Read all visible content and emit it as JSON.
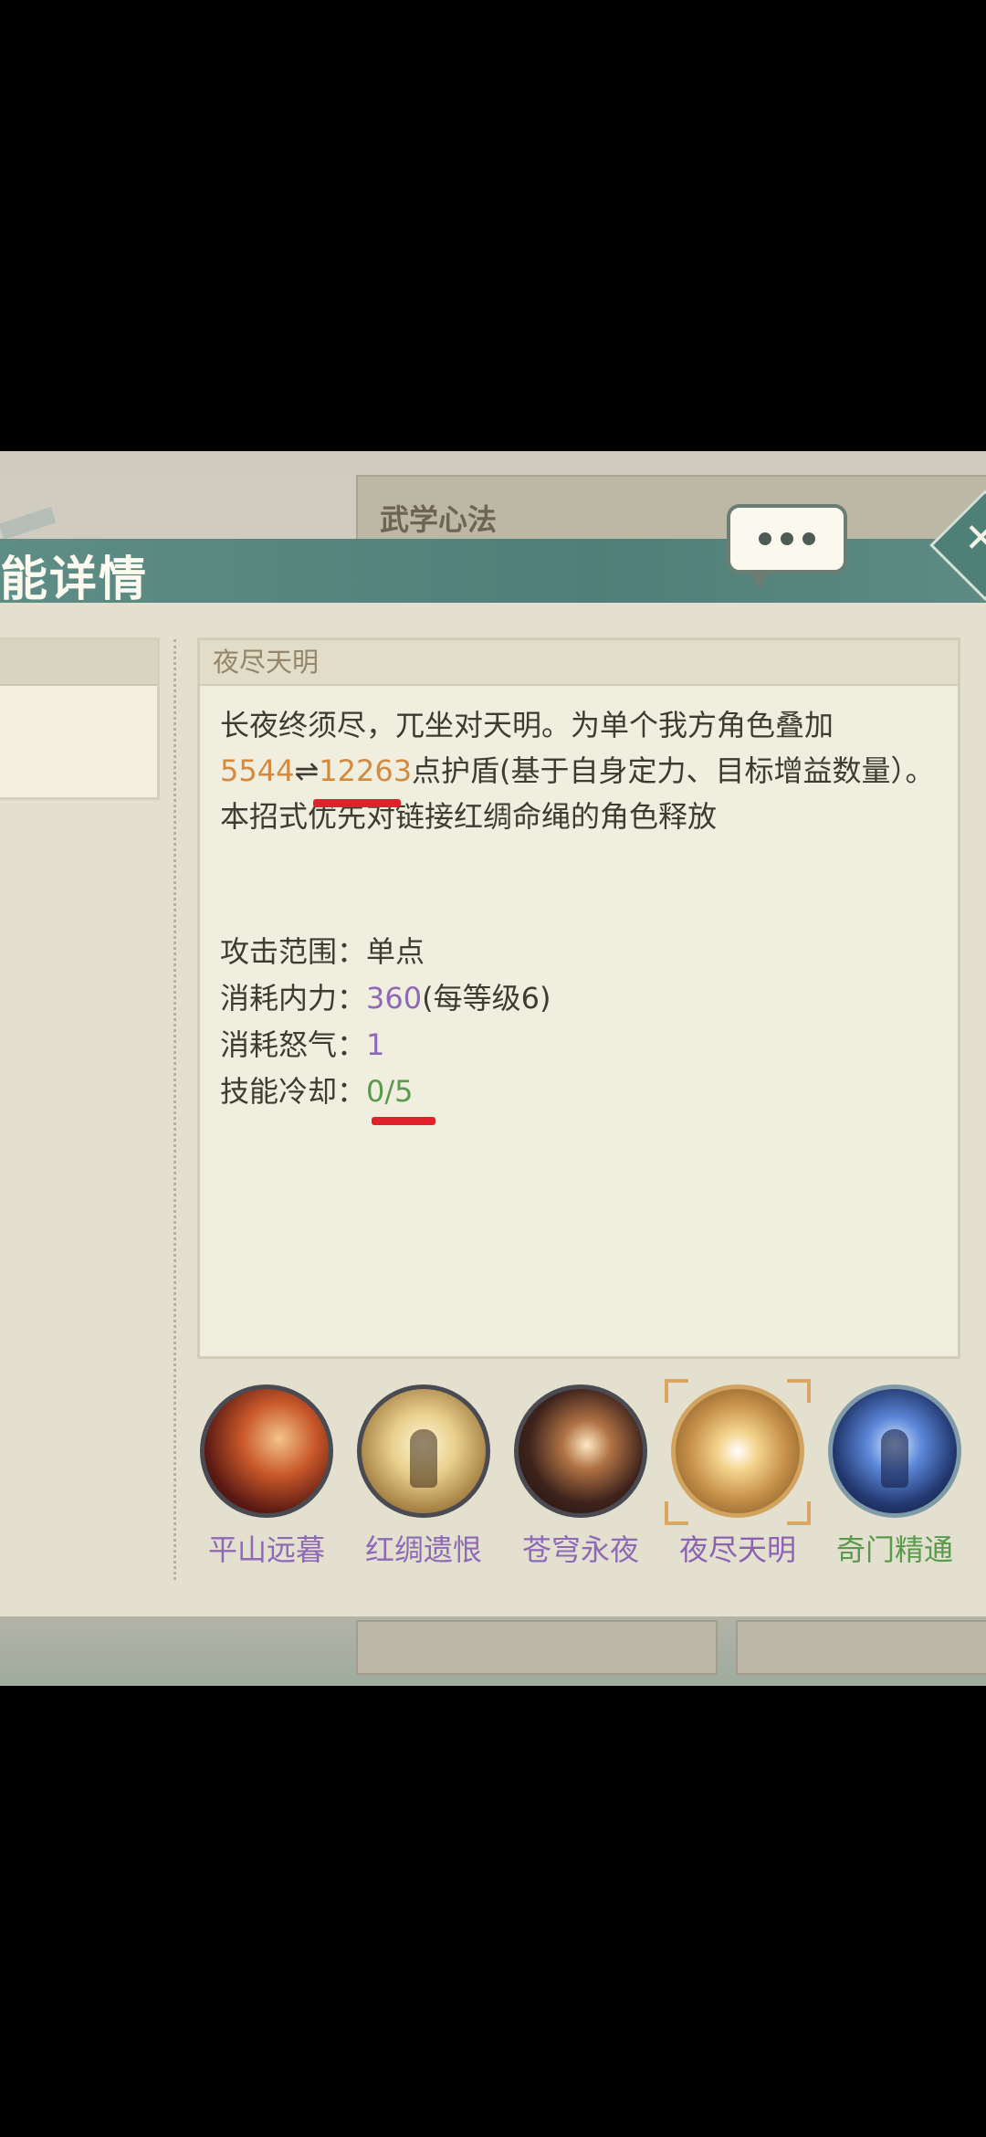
{
  "header": {
    "title": "能详情",
    "bg_tab_label": "武学心法"
  },
  "detail": {
    "skill_name": "夜尽天明",
    "desc_part1": "长夜终须尽，兀坐对天明。为单个我方角色叠加",
    "shield_low": "5544",
    "arrow": "⇌",
    "shield_high": "12263",
    "desc_part2": "点护盾(基于自身定力、目标增益数量）。",
    "desc_line2": "本招式优先对链接红绸命绳的角色释放",
    "stats": {
      "range_label": "攻击范围：",
      "range_value": "单点",
      "mp_label": "消耗内力：",
      "mp_value": "360",
      "mp_extra": "(每等级6)",
      "rage_label": "消耗怒气：",
      "rage_value": "1",
      "cd_label": "技能冷却：",
      "cd_value": "0/5"
    }
  },
  "skills": [
    {
      "label": "平山远暮",
      "icon": "swirl-icon"
    },
    {
      "label": "红绸遗恨",
      "icon": "glowing-figure-icon"
    },
    {
      "label": "苍穹永夜",
      "icon": "starburst-icon"
    },
    {
      "label": "夜尽天明",
      "icon": "radiant-sun-icon",
      "selected": true
    },
    {
      "label": "奇门精通",
      "icon": "blue-figure-icon"
    }
  ],
  "colors": {
    "header": "#4f7f78",
    "accent_orange": "#d38a3f",
    "accent_purple": "#8e69b5",
    "accent_green": "#5a9a4c",
    "annotation_red": "#e0202a"
  }
}
